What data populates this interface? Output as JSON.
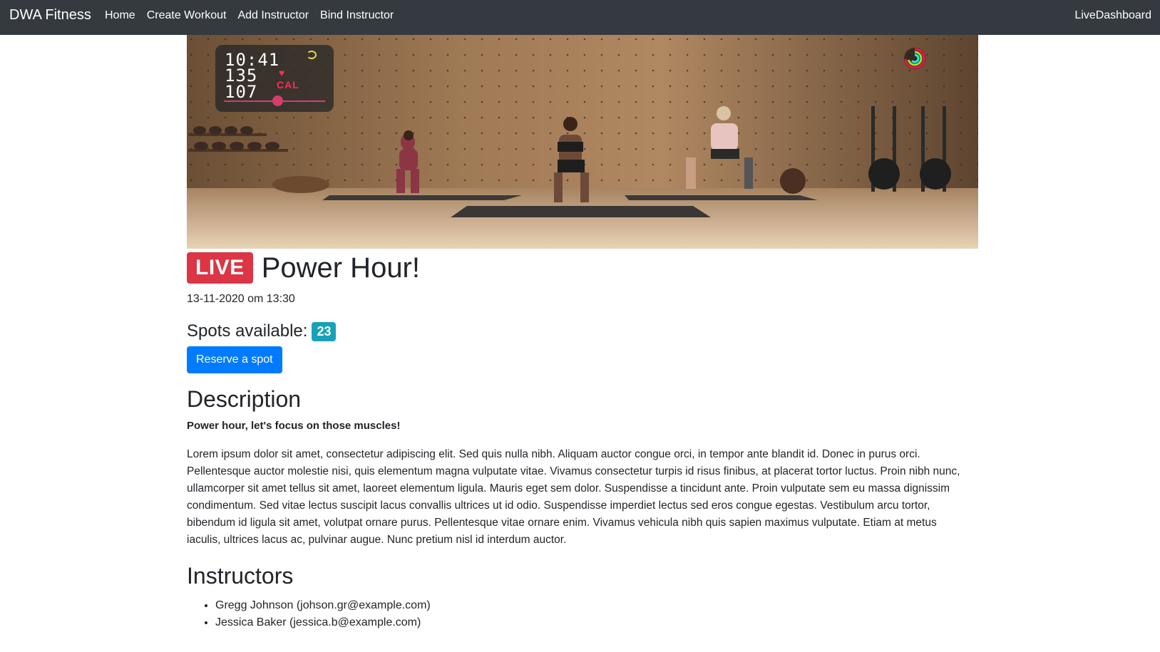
{
  "navbar": {
    "brand": "DWA Fitness",
    "links": [
      {
        "label": "Home"
      },
      {
        "label": "Create Workout"
      },
      {
        "label": "Add Instructor"
      },
      {
        "label": "Bind Instructor"
      }
    ],
    "right_link": "LiveDashboard"
  },
  "video": {
    "overlay": {
      "time": "10:41",
      "heart_rate": "135",
      "calories": "107",
      "calories_unit": "CAL"
    }
  },
  "workout": {
    "live_badge": "LIVE",
    "title": "Power Hour!",
    "date": "13-11-2020 om 13:30",
    "spots_label": "Spots available:",
    "spots_count": "23",
    "reserve_button": "Reserve a spot"
  },
  "description": {
    "heading": "Description",
    "lead": "Power hour, let's focus on those muscles!",
    "body": "Lorem ipsum dolor sit amet, consectetur adipiscing elit. Sed quis nulla nibh. Aliquam auctor congue orci, in tempor ante blandit id. Donec in purus orci. Pellentesque auctor molestie nisi, quis elementum magna vulputate vitae. Vivamus consectetur turpis id risus finibus, at placerat tortor luctus. Proin nibh nunc, ullamcorper sit amet tellus sit amet, laoreet elementum ligula. Mauris eget sem dolor. Suspendisse a tincidunt ante. Proin vulputate sem eu massa dignissim condimentum. Sed vitae lectus suscipit lacus convallis ultrices ut id odio. Suspendisse imperdiet lectus sed eros congue egestas. Vestibulum arcu tortor, bibendum id ligula sit amet, volutpat ornare purus. Pellentesque vitae ornare enim. Vivamus vehicula nibh quis sapien maximus vulputate. Etiam at metus iaculis, ultrices lacus ac, pulvinar augue. Nunc pretium nisl id interdum auctor."
  },
  "instructors": {
    "heading": "Instructors",
    "items": [
      "Gregg Johnson (johson.gr@example.com)",
      "Jessica Baker (jessica.b@example.com)"
    ]
  },
  "colors": {
    "navbar_bg": "#343a40",
    "live_badge": "#dc3545",
    "spots_badge": "#17a2b8",
    "primary_button": "#007bff"
  }
}
